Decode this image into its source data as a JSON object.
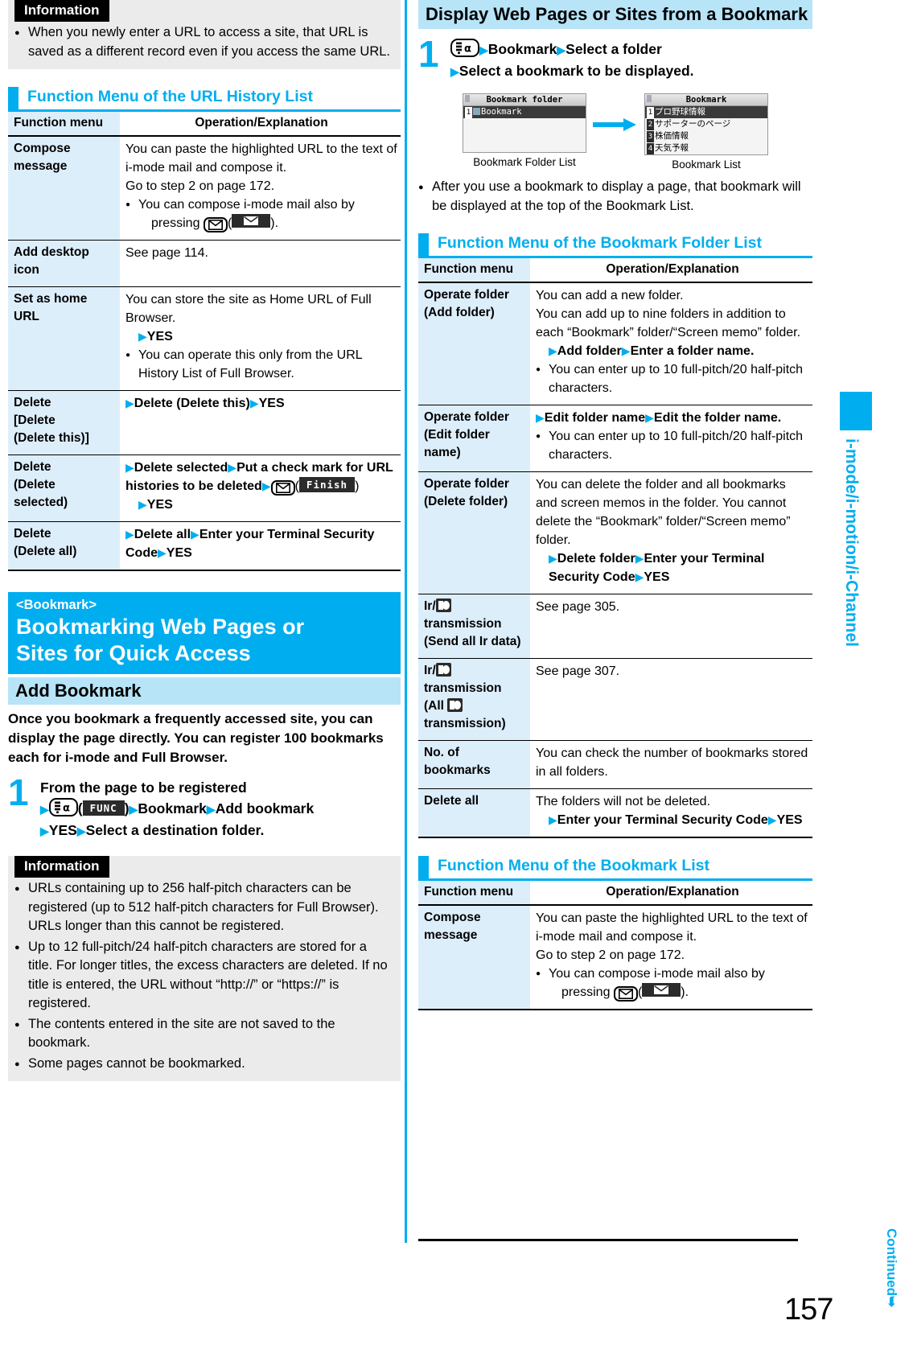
{
  "page": {
    "number": "157",
    "side_tab": "i-mode/i-motion/i-Channel",
    "continued": "Continued"
  },
  "left": {
    "info_top": {
      "tag": "Information",
      "items": [
        "When you newly enter a URL to access a site, that URL is saved as a different record even if you access the same URL."
      ]
    },
    "section1": {
      "heading": "Function Menu of the URL History List",
      "col1": "Function menu",
      "col2": "Operation/Explanation",
      "rows": [
        {
          "name": "Compose message",
          "lines": [
            "You can paste the highlighted URL to the text of i-mode mail and compose it.",
            "Go to step 2 on page 172."
          ],
          "bullet": "You can compose i-mode mail also by",
          "bullet_tail_pre": "pressing",
          "bullet_tail_post": ")."
        },
        {
          "name": "Add desktop icon",
          "lines": [
            "See page 114."
          ]
        },
        {
          "name": "Set as home URL",
          "lines": [
            "You can store the site as Home URL of Full Browser."
          ],
          "op": "YES",
          "bullet": "You can operate this only from the URL History List of Full Browser."
        },
        {
          "name": "Delete [Delete (Delete this)]",
          "op_seq": [
            "Delete (Delete this)",
            "YES"
          ]
        },
        {
          "name": "Delete (Delete selected)",
          "op_seq_a": [
            "Delete selected",
            "Put a check mark for URL histories to be deleted"
          ],
          "softkey": "Finish",
          "op_seq_b": [
            "YES"
          ]
        },
        {
          "name": "Delete (Delete all)",
          "op_seq": [
            "Delete all",
            "Enter your Terminal Security Code",
            "YES"
          ]
        }
      ]
    },
    "banner": {
      "kicker": "<Bookmark>",
      "title_line1": "Bookmarking Web Pages or",
      "title_line2": "Sites for Quick Access"
    },
    "subsection": {
      "title": "Add Bookmark",
      "lead": "Once you bookmark a frequently accessed site, you can display the page directly. You can register 100 bookmarks each for i-mode and Full Browser."
    },
    "step1": {
      "num": "1",
      "line1": "From the page to be registered",
      "softkey": "FUNC",
      "seq_after_key": [
        "Bookmark",
        "Add bookmark"
      ],
      "line3": [
        "YES",
        "Select a destination folder."
      ]
    },
    "info_bottom": {
      "tag": "Information",
      "items": [
        "URLs containing up to 256 half-pitch characters can be registered (up to 512 half-pitch characters for Full Browser). URLs longer than this cannot be registered.",
        "Up to 12 full-pitch/24 half-pitch characters are stored for a title. For longer titles, the excess characters are deleted. If no title is entered, the URL without “http://” or “https://” is registered.",
        "The contents entered in the site are not saved to the bookmark.",
        "Some pages cannot be bookmarked."
      ]
    }
  },
  "right": {
    "title": "Display Web Pages or Sites from a Bookmark",
    "step1": {
      "num": "1",
      "seq_after_key": [
        "Bookmark",
        "Select a folder"
      ],
      "line2": "Select a bookmark to be displayed."
    },
    "screens": {
      "folder_list": {
        "titlebar": "Bookmark folder",
        "items": [
          {
            "num": "1",
            "label": "Bookmark",
            "selected": true,
            "folder": true
          }
        ],
        "caption": "Bookmark Folder List"
      },
      "bookmark_list": {
        "titlebar": "Bookmark",
        "items": [
          {
            "num": "1",
            "label": "プロ野球情報",
            "selected": true
          },
          {
            "num": "2",
            "label": "サポーターのページ",
            "selected": false
          },
          {
            "num": "3",
            "label": "株価情報",
            "selected": false
          },
          {
            "num": "4",
            "label": "天気予報",
            "selected": false
          }
        ],
        "caption": "Bookmark List"
      }
    },
    "note": "After you use a bookmark to display a page, that bookmark will be displayed at the top of the Bookmark List.",
    "section_folder": {
      "heading": "Function Menu of the Bookmark Folder List",
      "col1": "Function menu",
      "col2": "Operation/Explanation",
      "rows": [
        {
          "name": "Operate folder (Add folder)",
          "lines": [
            "You can add a new folder.",
            "You can add up to nine folders in addition to each “Bookmark” folder/“Screen memo” folder."
          ],
          "op_seq": [
            "Add folder",
            "Enter a folder name."
          ],
          "bullet": "You can enter up to 10 full-pitch/20 half-pitch characters."
        },
        {
          "name": "Operate folder (Edit folder name)",
          "op_seq": [
            "Edit folder name",
            "Edit the folder name."
          ],
          "bullet": "You can enter up to 10 full-pitch/20 half-pitch characters."
        },
        {
          "name": "Operate folder (Delete folder)",
          "lines": [
            "You can delete the folder and all bookmarks and screen memos in the folder. You cannot delete the “Bookmark” folder/“Screen memo” folder."
          ],
          "op_seq": [
            "Delete folder",
            "Enter your Terminal Security Code",
            "YES"
          ]
        },
        {
          "name_pre": "Ir/",
          "name_post": " transmission (Send all Ir data)",
          "lines": [
            "See page 305."
          ]
        },
        {
          "name_pre2": "Ir/",
          "name_mid2": " transmission (All ",
          "name_post2": " transmission)",
          "lines": [
            "See page 307."
          ]
        },
        {
          "name": "No. of bookmarks",
          "lines": [
            "You can check the number of bookmarks stored in all folders."
          ]
        },
        {
          "name": "Delete all",
          "lines": [
            "The folders will not be deleted."
          ],
          "op_seq": [
            "Enter your Terminal Security Code",
            "YES"
          ]
        }
      ]
    },
    "section_list": {
      "heading": "Function Menu of the Bookmark List",
      "col1": "Function menu",
      "col2": "Operation/Explanation",
      "rows": [
        {
          "name": "Compose message",
          "lines": [
            "You can paste the highlighted URL to the text of i-mode mail and compose it.",
            "Go to step 2 on page 172."
          ],
          "bullet": "You can compose i-mode mail also by",
          "bullet_tail_pre": "pressing",
          "bullet_tail_post": ")."
        }
      ]
    }
  }
}
